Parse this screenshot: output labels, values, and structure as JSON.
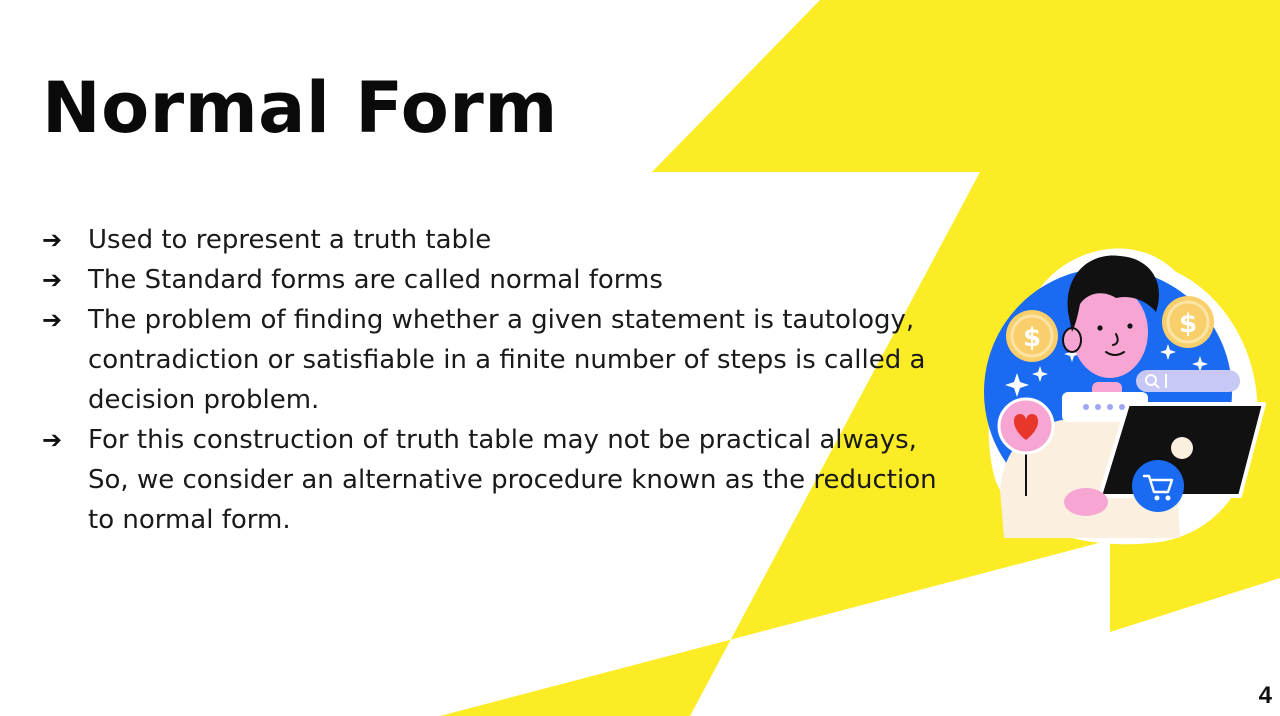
{
  "slide": {
    "title": "Normal Form",
    "bullets": [
      "Used to represent a truth table",
      "The Standard forms are called normal forms",
      "The problem of finding whether a given statement is tautology, contradiction or satisfiable in a finite number of steps is called a decision problem.",
      "For this construction of truth table may not be practical always, So, we consider an alternative procedure known as the reduction to normal form."
    ],
    "bullet_marker": "➔",
    "page_number": "4"
  },
  "illustration": {
    "coin_symbol": "$",
    "icons": [
      "coin-icon",
      "heart-icon",
      "search-bar-icon",
      "chat-bubble-icon",
      "laptop-icon",
      "cart-icon",
      "sparkle-icon"
    ]
  },
  "colors": {
    "accent_yellow": "#FBEC26",
    "blue": "#1B6BF2",
    "pink": "#F7A6D3",
    "coin": "#F9CF6B",
    "text": "#1a1a1a"
  }
}
